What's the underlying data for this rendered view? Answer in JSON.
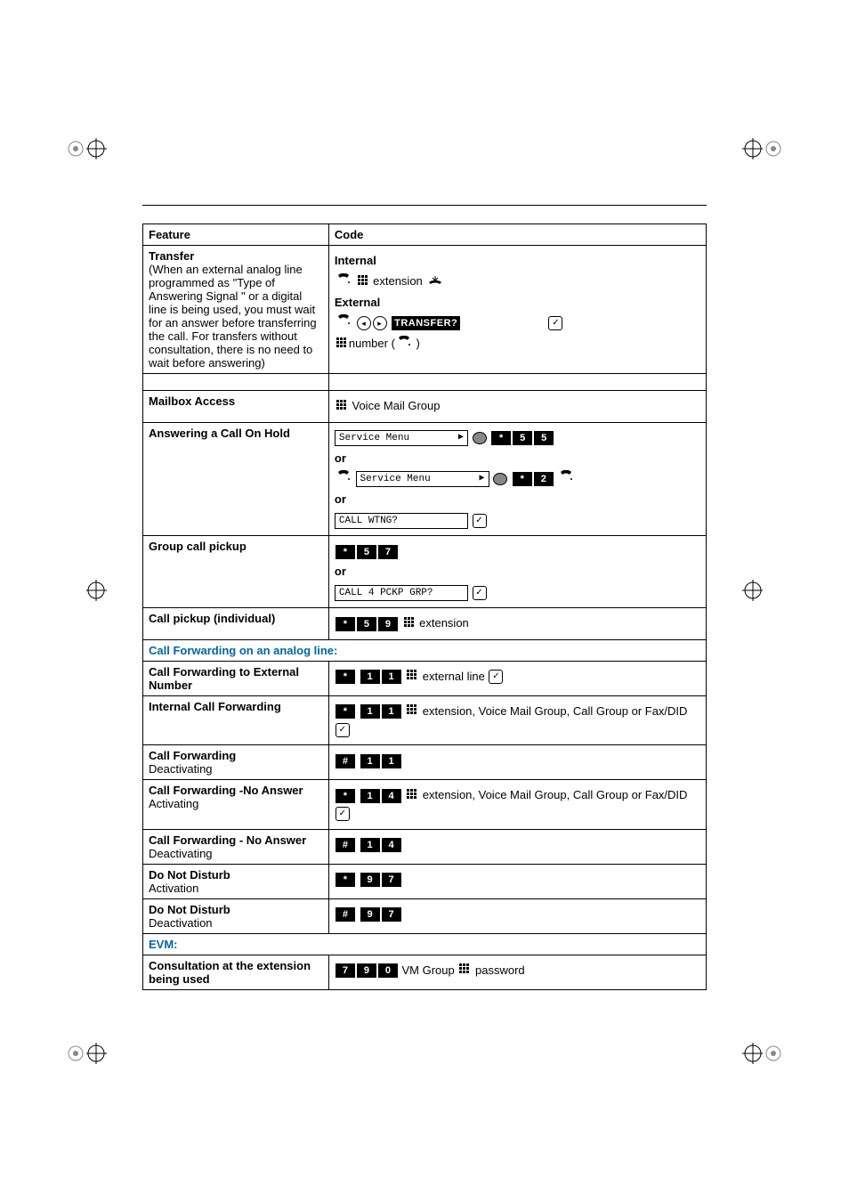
{
  "headers": {
    "feature": "Feature",
    "code": "Code"
  },
  "transfer": {
    "title": "Transfer",
    "description": "(When an external analog line programmed as \"Type of Answering Signal \" or a digital line is being used, you must wait for an answer before transferring the call. For transfers without consultation, there is no need to wait before answering)",
    "internal_label": "Internal",
    "external_label": "External",
    "extension_text": "extension",
    "number_text": "number (",
    "transfer_key": "TRANSFER?"
  },
  "mailbox": {
    "title": "Mailbox Access",
    "text": "Voice Mail Group"
  },
  "answer_hold": {
    "title": "Answering a Call On Hold",
    "service_menu": "Service Menu",
    "or": "or",
    "call_wtng": "CALL WTNG?"
  },
  "group_pickup": {
    "title": "Group call pickup",
    "or": "or",
    "call4": "CALL 4 PCKP GRP?"
  },
  "indiv_pickup": {
    "title": "Call pickup (individual)",
    "extension": "extension"
  },
  "cf_section": "Call Forwarding on an analog line:",
  "cf_external": {
    "title": "Call Forwarding to External Number",
    "text": "external line"
  },
  "cf_internal": {
    "title": "Internal Call Forwarding",
    "text": "extension, Voice Mail Group, Call Group or Fax/DID"
  },
  "cf_deact": {
    "title": "Call Forwarding",
    "sub": "Deactivating"
  },
  "cf_noans_act": {
    "title": "Call Forwarding -No Answer",
    "sub": "Activating",
    "text": "extension, Voice Mail Group, Call Group or Fax/DID"
  },
  "cf_noans_deact": {
    "title": "Call Forwarding - No Answer",
    "sub": "Deactivating"
  },
  "dnd_act": {
    "title": "Do Not Disturb",
    "sub": "Activation"
  },
  "dnd_deact": {
    "title": "Do Not Disturb",
    "sub": "Deactivation"
  },
  "evm_section": "EVM:",
  "consult": {
    "title": "Consultation at the extension being used",
    "vm": "VM Group",
    "pw": "password"
  },
  "keys": {
    "star": "*",
    "hash": "#",
    "d1": "1",
    "d2": "2",
    "d4": "4",
    "d5": "5",
    "d7": "7",
    "d9": "9",
    "d0": "0"
  }
}
